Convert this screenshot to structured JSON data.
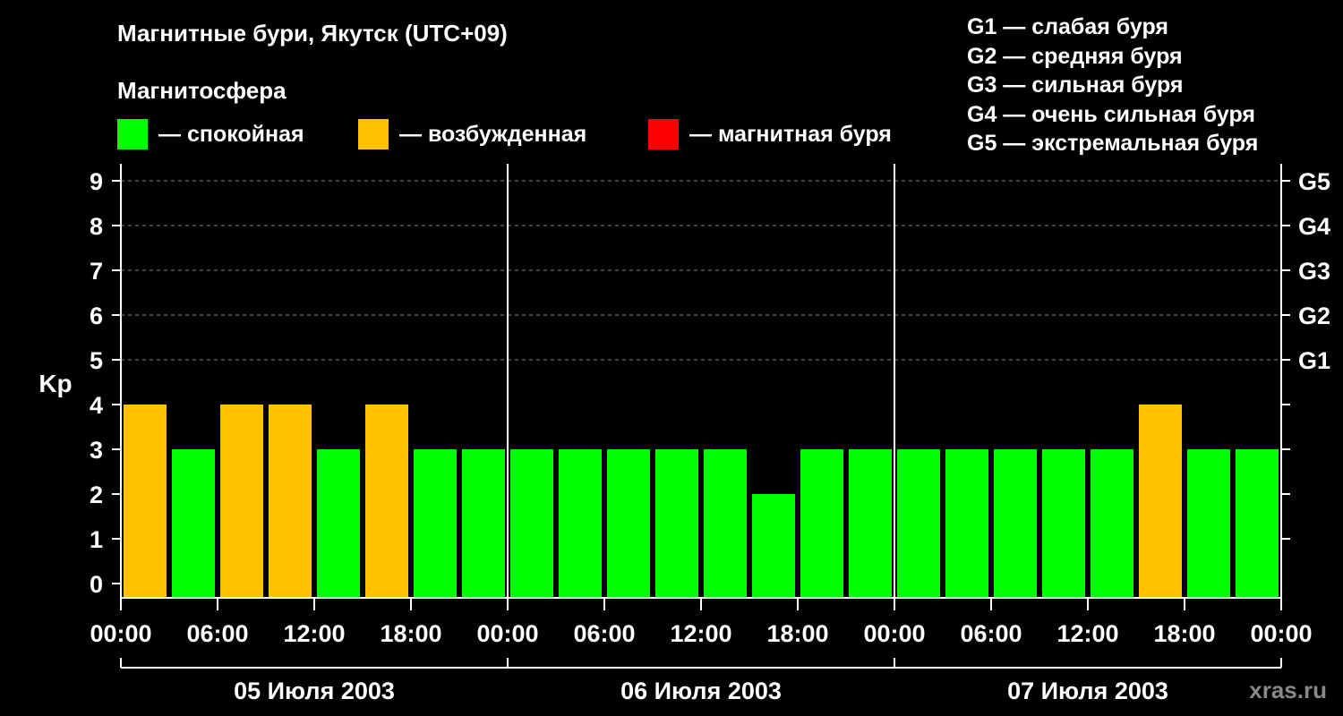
{
  "title": "Магнитные бури, Якутск (UTC+09)",
  "subtitle": "Магнитосфера",
  "legend": [
    {
      "label": "— спокойная",
      "color": "#00ff00"
    },
    {
      "label": "— возбужденная",
      "color": "#ffc000"
    },
    {
      "label": "— магнитная буря",
      "color": "#ff0000"
    }
  ],
  "g_legend": [
    "G1 — слабая буря",
    "G2 — средняя буря",
    "G3 — сильная буря",
    "G4 — очень сильная буря",
    "G5 — экстремальная буря"
  ],
  "watermark": "xras.ru",
  "chart_data": {
    "type": "bar",
    "ylabel": "Kp",
    "ylim": [
      0,
      9
    ],
    "y_ticks": [
      "0",
      "1",
      "2",
      "3",
      "4",
      "5",
      "6",
      "7",
      "8",
      "9"
    ],
    "right_axis_labels": [
      {
        "kp": 5,
        "label": "G1"
      },
      {
        "kp": 6,
        "label": "G2"
      },
      {
        "kp": 7,
        "label": "G3"
      },
      {
        "kp": 8,
        "label": "G4"
      },
      {
        "kp": 9,
        "label": "G5"
      }
    ],
    "x_tick_labels": [
      "00:00",
      "06:00",
      "12:00",
      "18:00",
      "00:00",
      "06:00",
      "12:00",
      "18:00",
      "00:00",
      "06:00",
      "12:00",
      "18:00",
      "00:00"
    ],
    "days": [
      "05 Июля 2003",
      "06 Июля 2003",
      "07 Июля 2003"
    ],
    "values": [
      4,
      3,
      4,
      4,
      3,
      4,
      3,
      3,
      3,
      3,
      3,
      3,
      3,
      2,
      3,
      3,
      3,
      3,
      3,
      3,
      3,
      4,
      3,
      3
    ],
    "colors": {
      "quiet": "#00ff00",
      "active": "#ffc000",
      "storm": "#ff0000",
      "grid": "#888888"
    },
    "grid": true
  }
}
